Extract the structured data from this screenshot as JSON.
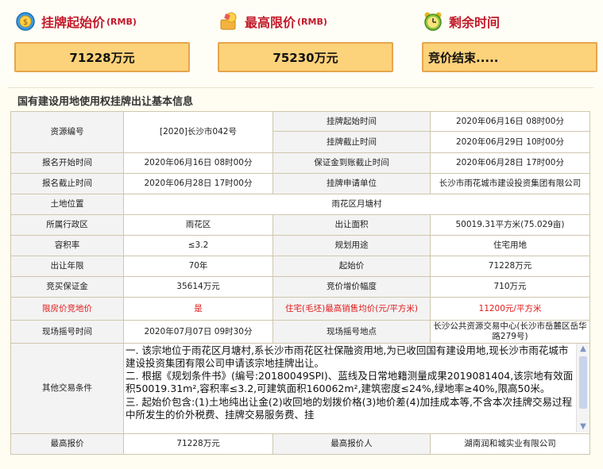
{
  "header": {
    "start_price_label": "挂牌起始价",
    "start_price_unit": "(RMB)",
    "start_price_value": "71228万元",
    "max_price_label": "最高限价",
    "max_price_unit": "(RMB)",
    "max_price_value": "75230万元",
    "remaining_label": "剩余时间",
    "remaining_value": "竞价结束....."
  },
  "section_title": "国有建设用地使用权挂牌出让基本信息",
  "table": {
    "resource_no_label": "资源编号",
    "resource_no": "[2020]长沙市042号",
    "listing_start_label": "挂牌起始时间",
    "listing_start": "2020年06月16日 08时00分",
    "listing_end_label": "挂牌截止时间",
    "listing_end": "2020年06月29日 10时00分",
    "apply_start_label": "报名开始时间",
    "apply_start": "2020年06月16日 08时00分",
    "deposit_deadline_label": "保证金到账截止时间",
    "deposit_deadline": "2020年06月28日 17时00分",
    "apply_end_label": "报名截止时间",
    "apply_end": "2020年06月28日 17时00分",
    "applicant_label": "挂牌申请单位",
    "applicant": "长沙市雨花城市建设投资集团有限公司",
    "location_label": "土地位置",
    "location": "雨花区月塘村",
    "district_label": "所属行政区",
    "district": "雨花区",
    "area_label": "出让面积",
    "area": "50019.31平方米(75.029亩)",
    "far_label": "容积率",
    "far": "≤3.2",
    "usage_label": "规划用途",
    "usage": "住宅用地",
    "term_label": "出让年限",
    "term": "70年",
    "start_price_label": "起始价",
    "start_price": "71228万元",
    "deposit_label": "竞买保证金",
    "deposit": "35614万元",
    "increment_label": "竞价增价幅度",
    "increment": "710万元",
    "limit_label": "限房价竞地价",
    "limit": "是",
    "avg_price_label": "住宅(毛坯)最高销售均价(元/平方米)",
    "avg_price": "11200元/平方米",
    "lottery_time_label": "现场摇号时间",
    "lottery_time": "2020年07月07日 09时30分",
    "lottery_place_label": "现场摇号地点",
    "lottery_place": "长沙公共资源交易中心(长沙市岳麓区岳华路279号)",
    "other_label": "其他交易条件",
    "other_1": "一. 该宗地位于雨花区月塘村,系长沙市雨花区社保融资用地,为已收回国有建设用地,现长沙市雨花城市建设投资集团有限公司申请该宗地挂牌出让。",
    "other_2": "二. 根据《规划条件书》(编号:20180049SPI)、蓝线及日常地籍测量成果2019081404,该宗地有效面积50019.31m²,容积率≤3.2,可建筑面积160062m²,建筑密度≤24%,绿地率≥40%,限高50米。",
    "other_3": "三. 起始价包含:(1)土地纯出让金(2)收回地的划拨价格(3)地价差(4)加挂成本等,不含本次挂牌交易过程中所发生的价外税费、挂牌交易服务费、挂",
    "max_bid_label": "最高报价",
    "max_bid": "71228万元",
    "max_bidder_label": "最高报价人",
    "max_bidder": "湖南润和城实业有限公司"
  },
  "icons": {
    "start_price": "money-cycle-icon",
    "max_price": "price-cap-icon",
    "remaining": "alarm-clock-icon"
  },
  "colors": {
    "accent_red": "#c2192a",
    "box_fill": "#fcd27a",
    "box_border": "#e6a64b"
  }
}
